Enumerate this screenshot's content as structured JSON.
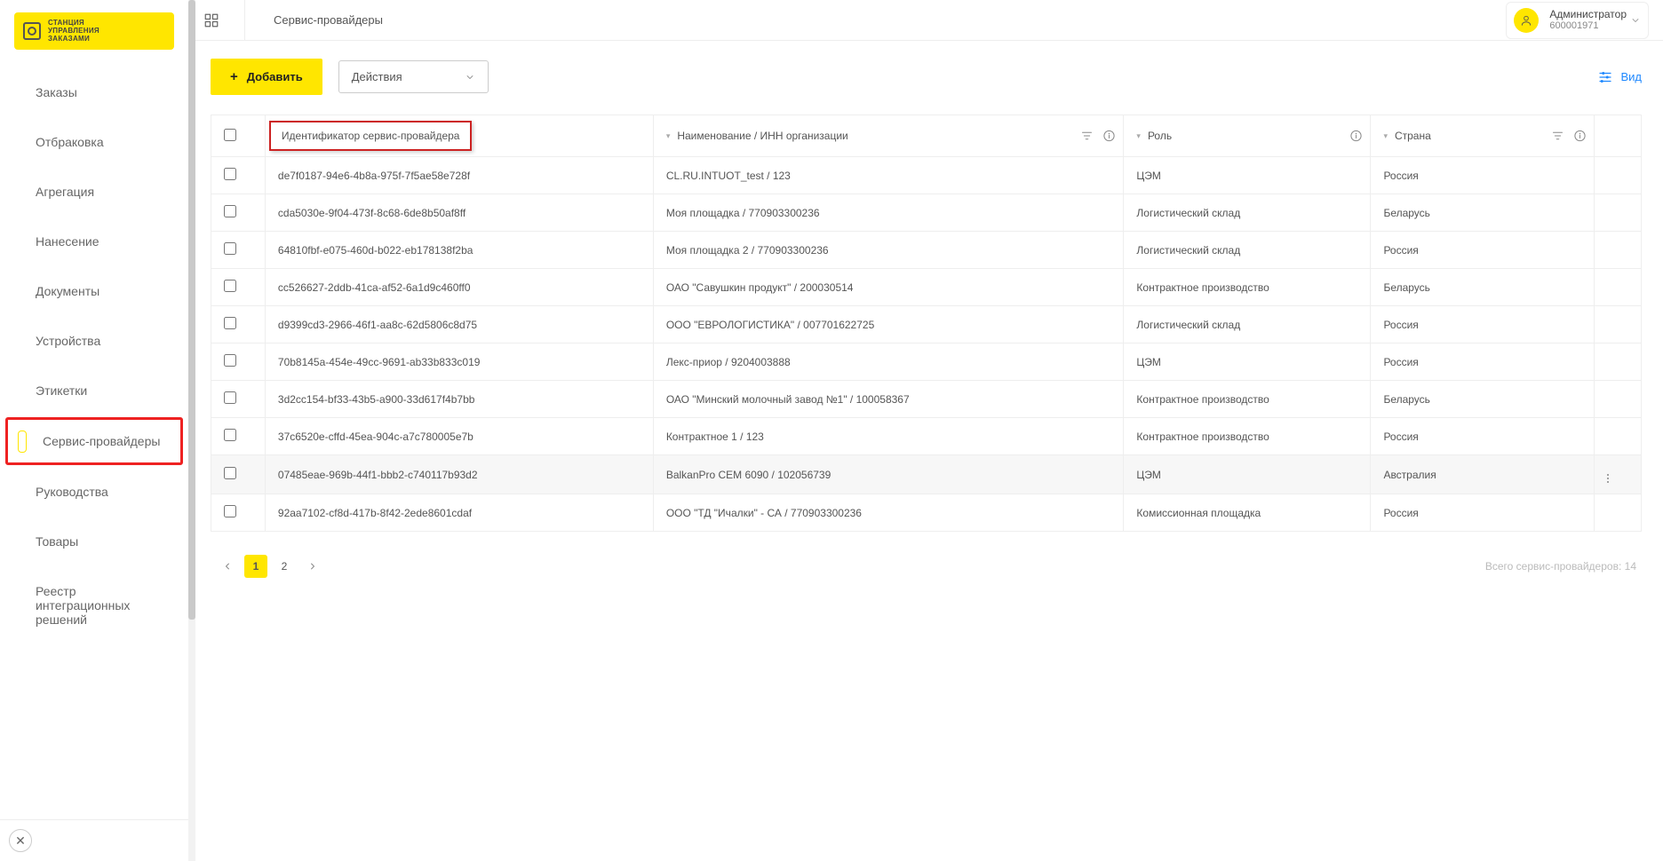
{
  "logo_text": "СТАНЦИЯ\nУПРАВЛЕНИЯ\nЗАКАЗАМИ",
  "page_title": "Сервис-провайдеры",
  "user": {
    "role": "Администратор",
    "id": "600001971"
  },
  "sidebar": {
    "items": [
      {
        "label": "Заказы"
      },
      {
        "label": "Отбраковка"
      },
      {
        "label": "Агрегация"
      },
      {
        "label": "Нанесение"
      },
      {
        "label": "Документы"
      },
      {
        "label": "Устройства"
      },
      {
        "label": "Этикетки"
      },
      {
        "label": "Сервис-провайдеры"
      },
      {
        "label": "Руководства"
      },
      {
        "label": "Товары"
      },
      {
        "label": "Реестр интеграционных решений"
      }
    ]
  },
  "toolbar": {
    "add_label": "Добавить",
    "actions_label": "Действия",
    "view_label": "Вид"
  },
  "table": {
    "columns": {
      "id": "Идентификатор сервис-провайдера",
      "name": "Наименование / ИНН организации",
      "role": "Роль",
      "country": "Страна"
    },
    "rows": [
      {
        "id": "de7f0187-94e6-4b8a-975f-7f5ae58e728f",
        "name": "CL.RU.INTUOT_test / 123",
        "role": "ЦЭМ",
        "country": "Россия"
      },
      {
        "id": "cda5030e-9f04-473f-8c68-6de8b50af8ff",
        "name": "Моя площадка / 770903300236",
        "role": "Логистический склад",
        "country": "Беларусь"
      },
      {
        "id": "64810fbf-e075-460d-b022-eb178138f2ba",
        "name": "Моя площадка 2 / 770903300236",
        "role": "Логистический склад",
        "country": "Россия"
      },
      {
        "id": "cc526627-2ddb-41ca-af52-6a1d9c460ff0",
        "name": "ОАО \"Савушкин продукт\" / 200030514",
        "role": "Контрактное производство",
        "country": "Беларусь"
      },
      {
        "id": "d9399cd3-2966-46f1-aa8c-62d5806c8d75",
        "name": "ООО \"ЕВРОЛОГИСТИКА\" / 007701622725",
        "role": "Логистический склад",
        "country": "Россия"
      },
      {
        "id": "70b8145a-454e-49cc-9691-ab33b833c019",
        "name": "Лекс-приор / 9204003888",
        "role": "ЦЭМ",
        "country": "Россия"
      },
      {
        "id": "3d2cc154-bf33-43b5-a900-33d617f4b7bb",
        "name": "ОАО \"Минский молочный завод №1\" / 100058367",
        "role": "Контрактное производство",
        "country": "Беларусь"
      },
      {
        "id": "37c6520e-cffd-45ea-904c-a7c780005e7b",
        "name": "Контрактное 1 / 123",
        "role": "Контрактное производство",
        "country": "Россия"
      },
      {
        "id": "07485eae-969b-44f1-bbb2-c740117b93d2",
        "name": "BalkanPro CEM 6090 / 102056739",
        "role": "ЦЭМ",
        "country": "Австралия",
        "hover": true
      },
      {
        "id": "92aa7102-cf8d-417b-8f42-2ede8601cdaf",
        "name": "ООО \"ТД \"Ичалки\" - СА / 770903300236",
        "role": "Комиссионная площадка",
        "country": "Россия"
      }
    ]
  },
  "pagination": {
    "current": 1,
    "pages": [
      1,
      2
    ],
    "total_label": "Всего сервис-провайдеров:",
    "total": 14
  }
}
